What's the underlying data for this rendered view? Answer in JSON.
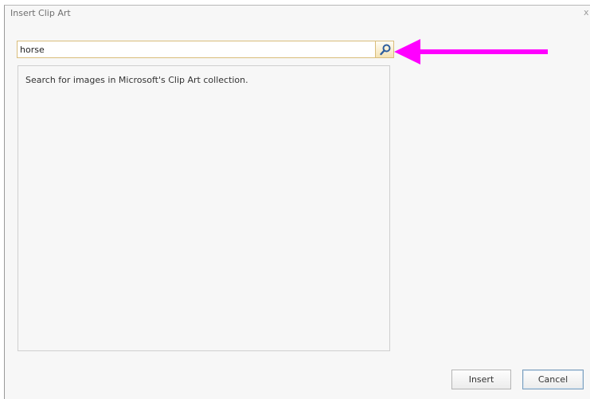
{
  "dialog": {
    "title": "Insert Clip Art",
    "close_glyph": "x"
  },
  "search": {
    "value": "horse",
    "button_icon": "search-icon"
  },
  "results": {
    "message": "Search for images in Microsoft's Clip Art collection."
  },
  "annotation": {
    "arrow_color": "#ff00ff"
  },
  "buttons": {
    "insert_label": "Insert",
    "cancel_label": "Cancel"
  }
}
